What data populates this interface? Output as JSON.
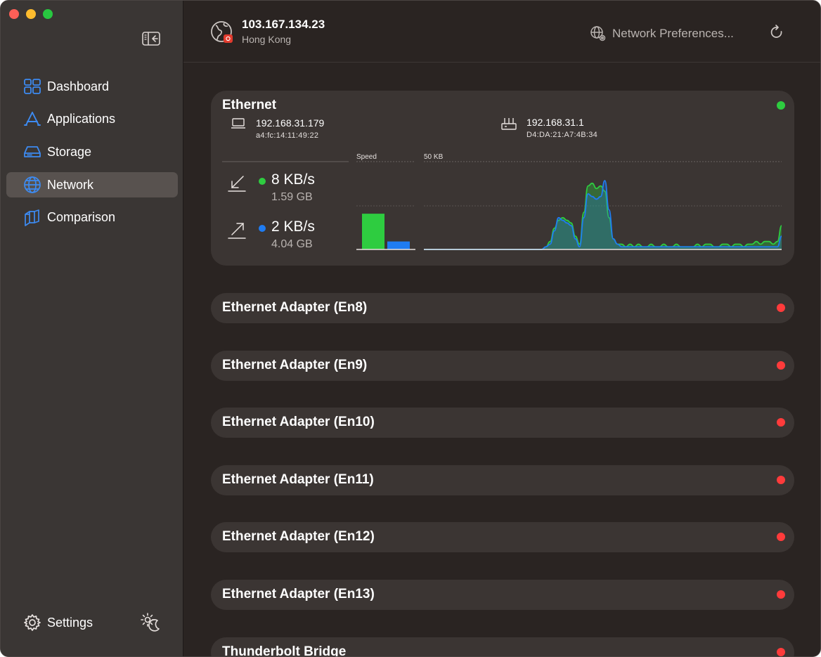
{
  "colors": {
    "accent": "#3d8bf2",
    "download": "#2ecc40",
    "upload": "#1f7cf2",
    "status_ok": "#2ecc40",
    "status_off": "#ff3b3b"
  },
  "sidebar": {
    "items": [
      {
        "label": "Dashboard",
        "icon": "dashboard-grid-icon"
      },
      {
        "label": "Applications",
        "icon": "app-store-icon"
      },
      {
        "label": "Storage",
        "icon": "drive-icon"
      },
      {
        "label": "Network",
        "icon": "globe-icon",
        "active": true
      },
      {
        "label": "Comparison",
        "icon": "cubes-icon"
      }
    ],
    "settings_label": "Settings"
  },
  "header": {
    "public_ip": "103.167.134.23",
    "location": "Hong Kong",
    "prefs_label": "Network Preferences..."
  },
  "ethernet": {
    "title": "Ethernet",
    "status": "connected",
    "local_ip": "192.168.31.179",
    "local_mac": "a4:fc:14:11:49:22",
    "router_ip": "192.168.31.1",
    "router_mac": "D4:DA:21:A7:4B:34",
    "download_speed": "8 KB/s",
    "download_total": "1.59 GB",
    "upload_speed": "2 KB/s",
    "upload_total": "4.04 GB",
    "speed_label": "Speed",
    "scale_label": "50 KB"
  },
  "chart_data": {
    "type": "area",
    "title": "",
    "ylabel": "",
    "ylim": [
      0,
      50
    ],
    "bars": {
      "download": 11,
      "upload": 3.5
    },
    "series": [
      {
        "color": "#2ecc40",
        "values": [
          0,
          0,
          0,
          0,
          0,
          0,
          0,
          0,
          0,
          0,
          0,
          0,
          0,
          0,
          0,
          0,
          0,
          0,
          0,
          0,
          0,
          0,
          0,
          0,
          0,
          0,
          0,
          0,
          0,
          1,
          3,
          8,
          11,
          12,
          11,
          10,
          5,
          2,
          14,
          24,
          25,
          23,
          24,
          22,
          12,
          4,
          2,
          2,
          1,
          2,
          1,
          2,
          1,
          1,
          2,
          1,
          1,
          2,
          1,
          1,
          2,
          1,
          1,
          1,
          1,
          2,
          1,
          2,
          2,
          1,
          1,
          2,
          2,
          1,
          2,
          2,
          1,
          2,
          2,
          3,
          2,
          3,
          3,
          2,
          3,
          9
        ]
      },
      {
        "color": "#1f7cf2",
        "values": [
          0,
          0,
          0,
          0,
          0,
          0,
          0,
          0,
          0,
          0,
          0,
          0,
          0,
          0,
          0,
          0,
          0,
          0,
          0,
          0,
          0,
          0,
          0,
          0,
          0,
          0,
          0,
          0,
          0,
          1,
          2,
          7,
          12,
          11,
          10,
          9,
          4,
          1,
          12,
          21,
          20,
          19,
          20,
          26,
          15,
          4,
          2,
          1,
          1,
          1,
          1,
          1,
          1,
          1,
          1,
          1,
          1,
          1,
          1,
          1,
          1,
          1,
          1,
          1,
          1,
          1,
          1,
          1,
          1,
          1,
          1,
          1,
          1,
          1,
          1,
          1,
          1,
          1,
          1,
          1,
          1,
          1,
          1,
          1,
          1,
          5
        ]
      }
    ]
  },
  "adapters": [
    {
      "title": "Ethernet Adapter (En8)"
    },
    {
      "title": "Ethernet Adapter (En9)"
    },
    {
      "title": "Ethernet Adapter (En10)"
    },
    {
      "title": "Ethernet Adapter (En11)"
    },
    {
      "title": "Ethernet Adapter (En12)"
    },
    {
      "title": "Ethernet Adapter (En13)"
    },
    {
      "title": "Thunderbolt Bridge"
    }
  ]
}
